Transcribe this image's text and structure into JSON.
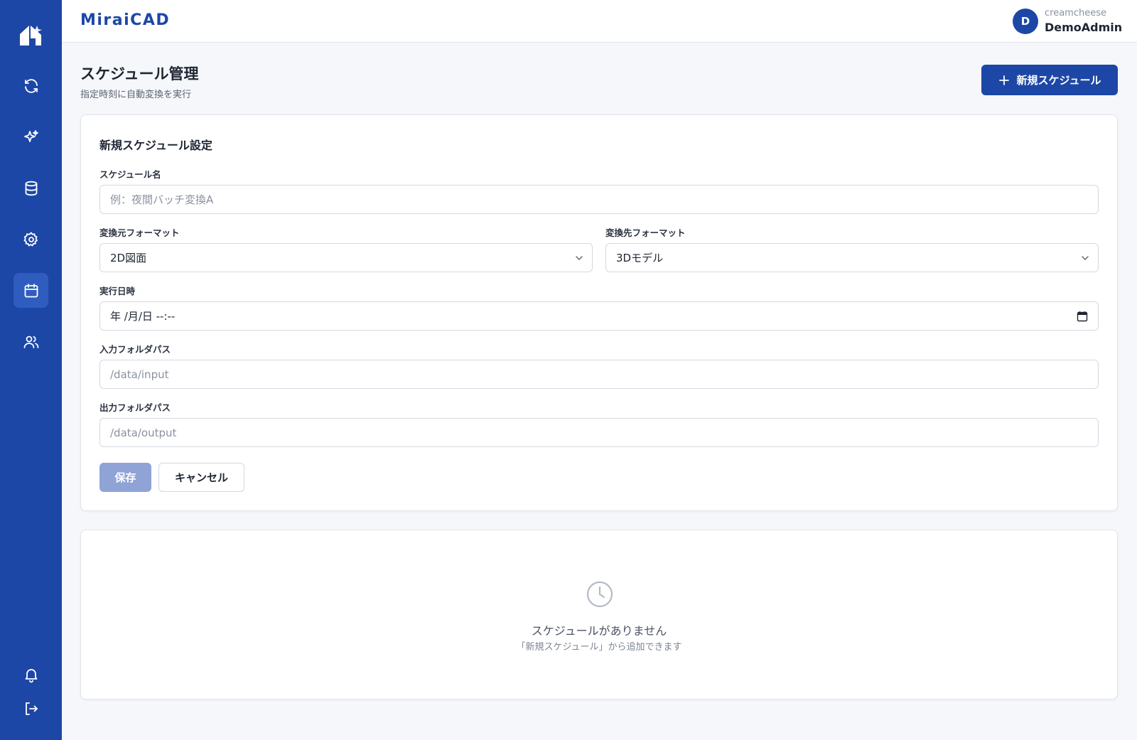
{
  "app": {
    "brand": "MiraiCAD"
  },
  "user": {
    "avatar_initial": "D",
    "org": "creamcheese",
    "name": "DemoAdmin"
  },
  "sidebar": {
    "items": [
      {
        "icon": "home-icon"
      },
      {
        "icon": "refresh-icon"
      },
      {
        "icon": "sparkles-icon"
      },
      {
        "icon": "database-icon"
      },
      {
        "icon": "gear-icon"
      },
      {
        "icon": "calendar-icon",
        "active": true
      },
      {
        "icon": "users-icon"
      },
      {
        "icon": "bell-icon"
      },
      {
        "icon": "logout-icon"
      }
    ]
  },
  "header": {
    "title": "スケジュール管理",
    "subtitle": "指定時刻に自動変換を実行",
    "new_button_label": "新規スケジュール"
  },
  "form": {
    "title": "新規スケジュール設定",
    "name_label": "スケジュール名",
    "name_placeholder": "例：夜間バッチ変換A",
    "source_label": "変換元フォーマット",
    "source_value": "2D図面",
    "target_label": "変換先フォーマット",
    "target_value": "3Dモデル",
    "datetime_label": "実行日時",
    "datetime_value": "年 /月/日 --:--",
    "input_label": "入力フォルダパス",
    "input_placeholder": "/data/input",
    "output_label": "出力フォルダパス",
    "output_placeholder": "/data/output",
    "save_label": "保存",
    "cancel_label": "キャンセル"
  },
  "empty_state": {
    "title": "スケジュールがありません",
    "subtitle": "「新規スケジュール」から追加できます"
  },
  "colors": {
    "primary": "#1d47a6",
    "primary_disabled": "#8fa3d6",
    "background": "#f5f7fa"
  }
}
